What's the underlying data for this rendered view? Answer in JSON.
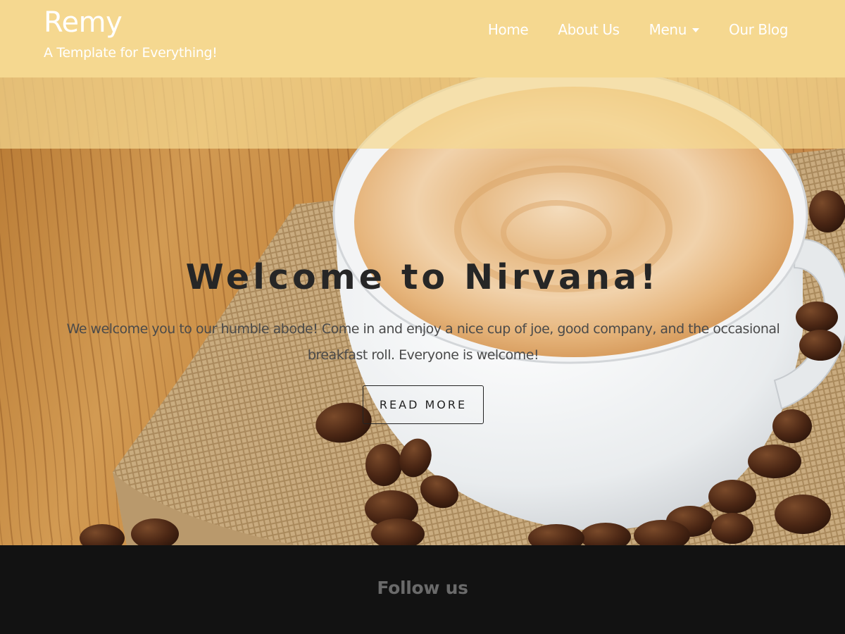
{
  "brand": {
    "title": "Remy",
    "tagline": "A Template for Everything!"
  },
  "nav": {
    "items": [
      {
        "label": "Home"
      },
      {
        "label": "About Us"
      },
      {
        "label": "Menu",
        "has_dropdown": true
      },
      {
        "label": "Our Blog"
      }
    ]
  },
  "hero": {
    "image": "coffee-cup-with-beans",
    "title": "Welcome to Nirvana!",
    "text": "We welcome you to our humble abode! Come in and enjoy a nice cup of joe, good company, and the occasional breakfast roll. Everyone is welcome!",
    "button_label": "READ MORE"
  },
  "footer": {
    "title": "Follow us"
  },
  "colors": {
    "header_bg": "#f5d890",
    "header_text": "#ffffff",
    "footer_bg": "#121212",
    "footer_text": "#6a6a6a",
    "hero_title": "#262626"
  }
}
